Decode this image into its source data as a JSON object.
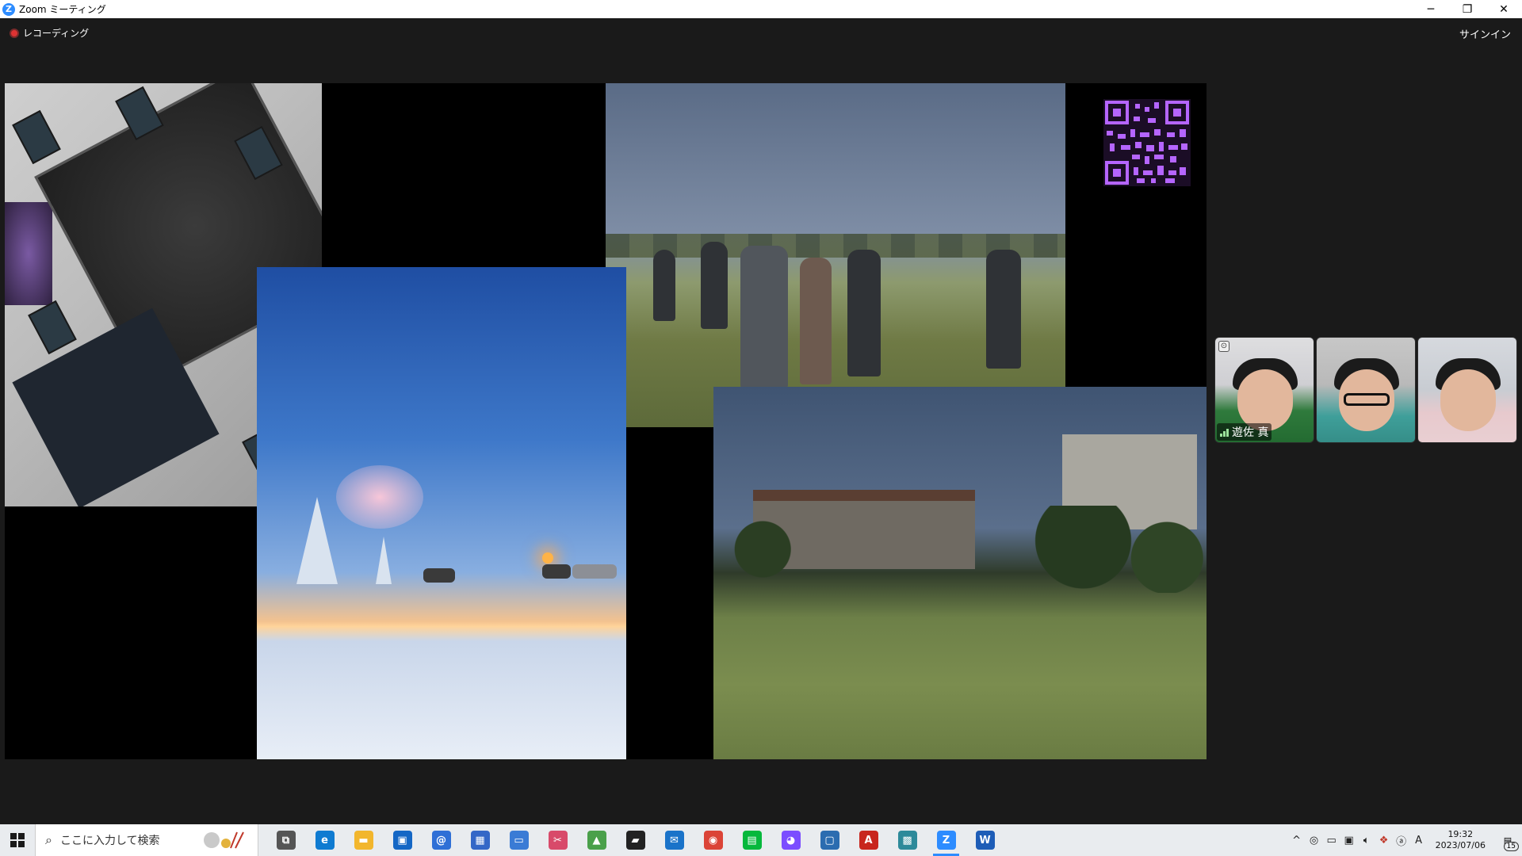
{
  "window": {
    "title": "Zoom ミーティング",
    "app_icon_letter": "Z",
    "minimize": "─",
    "restore": "❐",
    "close": "✕"
  },
  "meeting": {
    "recording_label": "レコーディング",
    "signin_label": "サインイン"
  },
  "participants": [
    {
      "name": "遊佐 真",
      "show_name": true
    },
    {
      "name": "",
      "show_name": false
    },
    {
      "name": "",
      "show_name": false
    }
  ],
  "taskbar": {
    "search_placeholder": "ここに入力して検索",
    "apps": [
      {
        "name": "task-view",
        "glyph": "⧉",
        "color": "#555555"
      },
      {
        "name": "edge",
        "glyph": "e",
        "color": "#0f7bd1"
      },
      {
        "name": "file-explorer",
        "glyph": "▬",
        "color": "#f2b62d"
      },
      {
        "name": "store",
        "glyph": "▣",
        "color": "#1467c5"
      },
      {
        "name": "mail-at",
        "glyph": "@",
        "color": "#2f6fd6"
      },
      {
        "name": "calendar-grid",
        "glyph": "▦",
        "color": "#3467c7"
      },
      {
        "name": "window-app",
        "glyph": "▭",
        "color": "#3a7bd5"
      },
      {
        "name": "snip-app",
        "glyph": "✂",
        "color": "#d84a6a"
      },
      {
        "name": "photos",
        "glyph": "▲",
        "color": "#4aa04a"
      },
      {
        "name": "sticky-notes",
        "glyph": "▰",
        "color": "#222222"
      },
      {
        "name": "mail",
        "glyph": "✉",
        "color": "#1a73c9"
      },
      {
        "name": "chrome",
        "glyph": "◉",
        "color": "#db4437"
      },
      {
        "name": "line",
        "glyph": "▤",
        "color": "#06b83c"
      },
      {
        "name": "messenger",
        "glyph": "◕",
        "color": "#7b4dff"
      },
      {
        "name": "remote-desktop",
        "glyph": "▢",
        "color": "#2b6cb0"
      },
      {
        "name": "acrobat",
        "glyph": "A",
        "color": "#c8261e"
      },
      {
        "name": "network-app",
        "glyph": "▩",
        "color": "#2d8a9a"
      },
      {
        "name": "zoom",
        "glyph": "Z",
        "color": "#2d8cff",
        "active": true
      },
      {
        "name": "word",
        "glyph": "W",
        "color": "#1e5db7"
      }
    ],
    "tray": {
      "chevron": "^",
      "time": "19:32",
      "date": "2023/07/06",
      "ime": "A",
      "notification_count": "15"
    }
  }
}
